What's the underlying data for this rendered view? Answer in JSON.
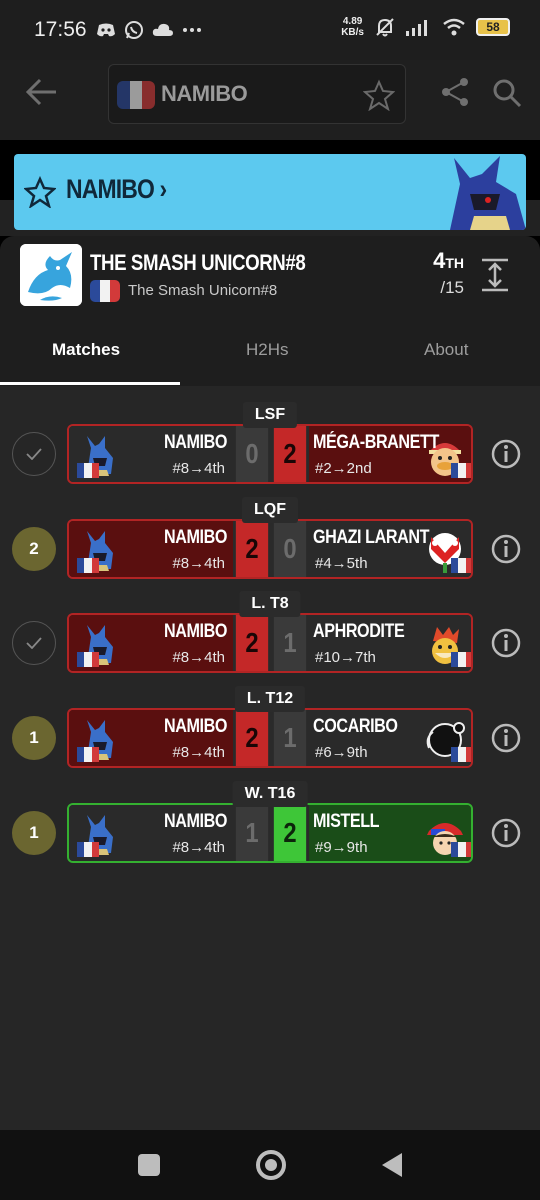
{
  "status_bar": {
    "time": "17:56",
    "speed_value": "4.89",
    "speed_unit": "KB/s",
    "battery": "58",
    "notification_icons": [
      "discord-icon",
      "whatsapp-icon",
      "cloud-icon",
      "more-dots-icon"
    ]
  },
  "app_bar": {
    "player_name": "NAMIBO"
  },
  "banner": {
    "player_name": "NAMIBO"
  },
  "tournament": {
    "title": "THE SMASH UNICORN#8",
    "subtitle": "The Smash Unicorn#8",
    "placement_number": "4",
    "placement_suffix": "TH",
    "placement_total": "/15"
  },
  "tabs": [
    {
      "label": "Matches",
      "active": true
    },
    {
      "label": "H2Hs",
      "active": false
    },
    {
      "label": "About",
      "active": false
    }
  ],
  "matches": [
    {
      "round": "LSF",
      "status": "check",
      "left": {
        "name": "NAMIBO",
        "seed": "#8→4th",
        "score": "0",
        "character": "lucario"
      },
      "right": {
        "name": "MÉGA-BRANETT",
        "seed": "#2→2nd",
        "score": "2",
        "character": "king-dedede"
      },
      "result": "loss"
    },
    {
      "round": "LQF",
      "status": "2",
      "left": {
        "name": "NAMIBO",
        "seed": "#8→4th",
        "score": "2",
        "character": "lucario"
      },
      "right": {
        "name": "GHAZI LARANT",
        "seed": "#4→5th",
        "score": "0",
        "character": "piranha-plant"
      },
      "result": "win"
    },
    {
      "round": "L. T8",
      "status": "check",
      "left": {
        "name": "NAMIBO",
        "seed": "#8→4th",
        "score": "2",
        "character": "lucario"
      },
      "right": {
        "name": "APHRODITE",
        "seed": "#10→7th",
        "score": "1",
        "character": "bowser"
      },
      "result": "win"
    },
    {
      "round": "L. T12",
      "status": "1",
      "left": {
        "name": "NAMIBO",
        "seed": "#8→4th",
        "score": "2",
        "character": "lucario"
      },
      "right": {
        "name": "COCARIBO",
        "seed": "#6→9th",
        "score": "1",
        "character": "game-and-watch"
      },
      "result": "win"
    },
    {
      "round": "W. T16",
      "status": "1",
      "left": {
        "name": "NAMIBO",
        "seed": "#8→4th",
        "score": "1",
        "character": "lucario"
      },
      "right": {
        "name": "MISTELL",
        "seed": "#9→9th",
        "score": "2",
        "character": "ness"
      },
      "result": "loss"
    }
  ],
  "colors": {
    "banner": "#5cc9ef",
    "loss_border": "#b22424",
    "win_border": "#34b030",
    "score_red": "#c42828",
    "score_green": "#3ec638",
    "status_count": "#6b6630"
  }
}
